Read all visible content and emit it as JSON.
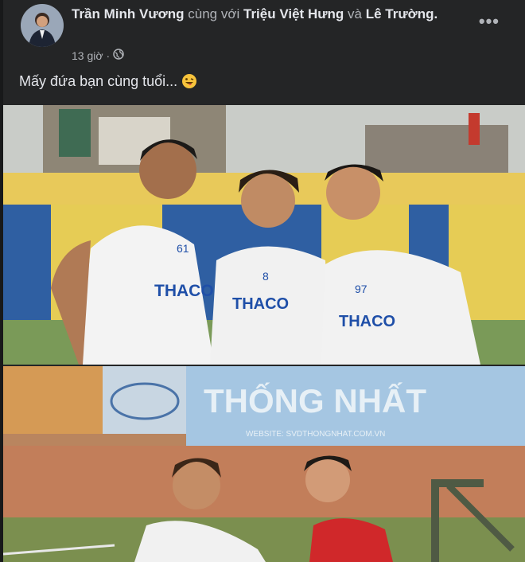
{
  "post": {
    "author": "Trần Minh Vương",
    "with_word": "cùng với",
    "tag1": "Triệu Việt Hưng",
    "and_word": "và",
    "tag2": "Lê Trường.",
    "time": "13 giờ",
    "dot": "·",
    "caption": "Mấy đứa bạn cùng tuổi...",
    "more_label": "•••"
  },
  "photos": {
    "jersey_sponsor": "THACO",
    "numbers": [
      "61",
      "8",
      "97"
    ],
    "stadium_sign": "THỐNG NHẤT",
    "stadium_url": "WEBSITE: SVDTHONGNHAT.COM.VN"
  },
  "colors": {
    "background": "#18191a",
    "card": "#242526",
    "text_primary": "#e4e6eb",
    "text_secondary": "#b0b3b8"
  },
  "icons": [
    "globe-icon",
    "more-options-icon",
    "emoji-face-icon"
  ]
}
